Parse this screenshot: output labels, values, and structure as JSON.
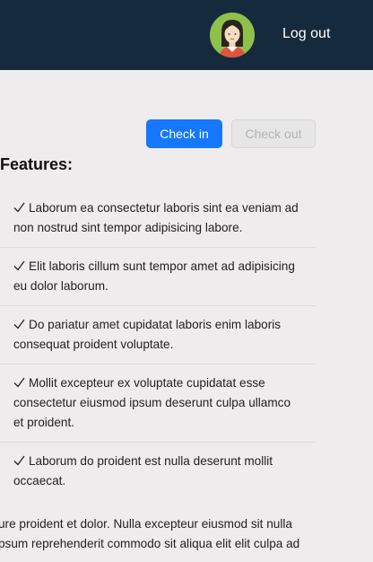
{
  "header": {
    "logout_label": "Log out",
    "colors": {
      "background": "#152a3d",
      "avatar_bg": "#8fc04a"
    },
    "avatar_icon": "user-avatar-icon"
  },
  "actions": {
    "checkin_label": "Check in",
    "checkout_label": "Check out",
    "checkin_color": "#1677ff"
  },
  "features": {
    "title": "Features:",
    "items": [
      "Laborum ea consectetur laboris sint ea veniam ad non nostrud sint tempor adipisicing labore.",
      "Elit laboris cillum sunt tempor amet ad adipisicing eu dolor laborum.",
      "Do pariatur amet cupidatat laboris enim laboris consequat proident voluptate.",
      "Mollit excepteur ex voluptate cupidatat esse consectetur eiusmod ipsum deserunt culpa ullamco et proident.",
      "Laborum do proident est nulla deserunt mollit occaecat."
    ],
    "item_icon": "checkmark-icon"
  },
  "body_text": {
    "line1": "ure proident et dolor. Nulla excepteur eiusmod sit nulla",
    "line2": "psum reprehenderit commodo sit aliqua elit elit culpa ad"
  }
}
